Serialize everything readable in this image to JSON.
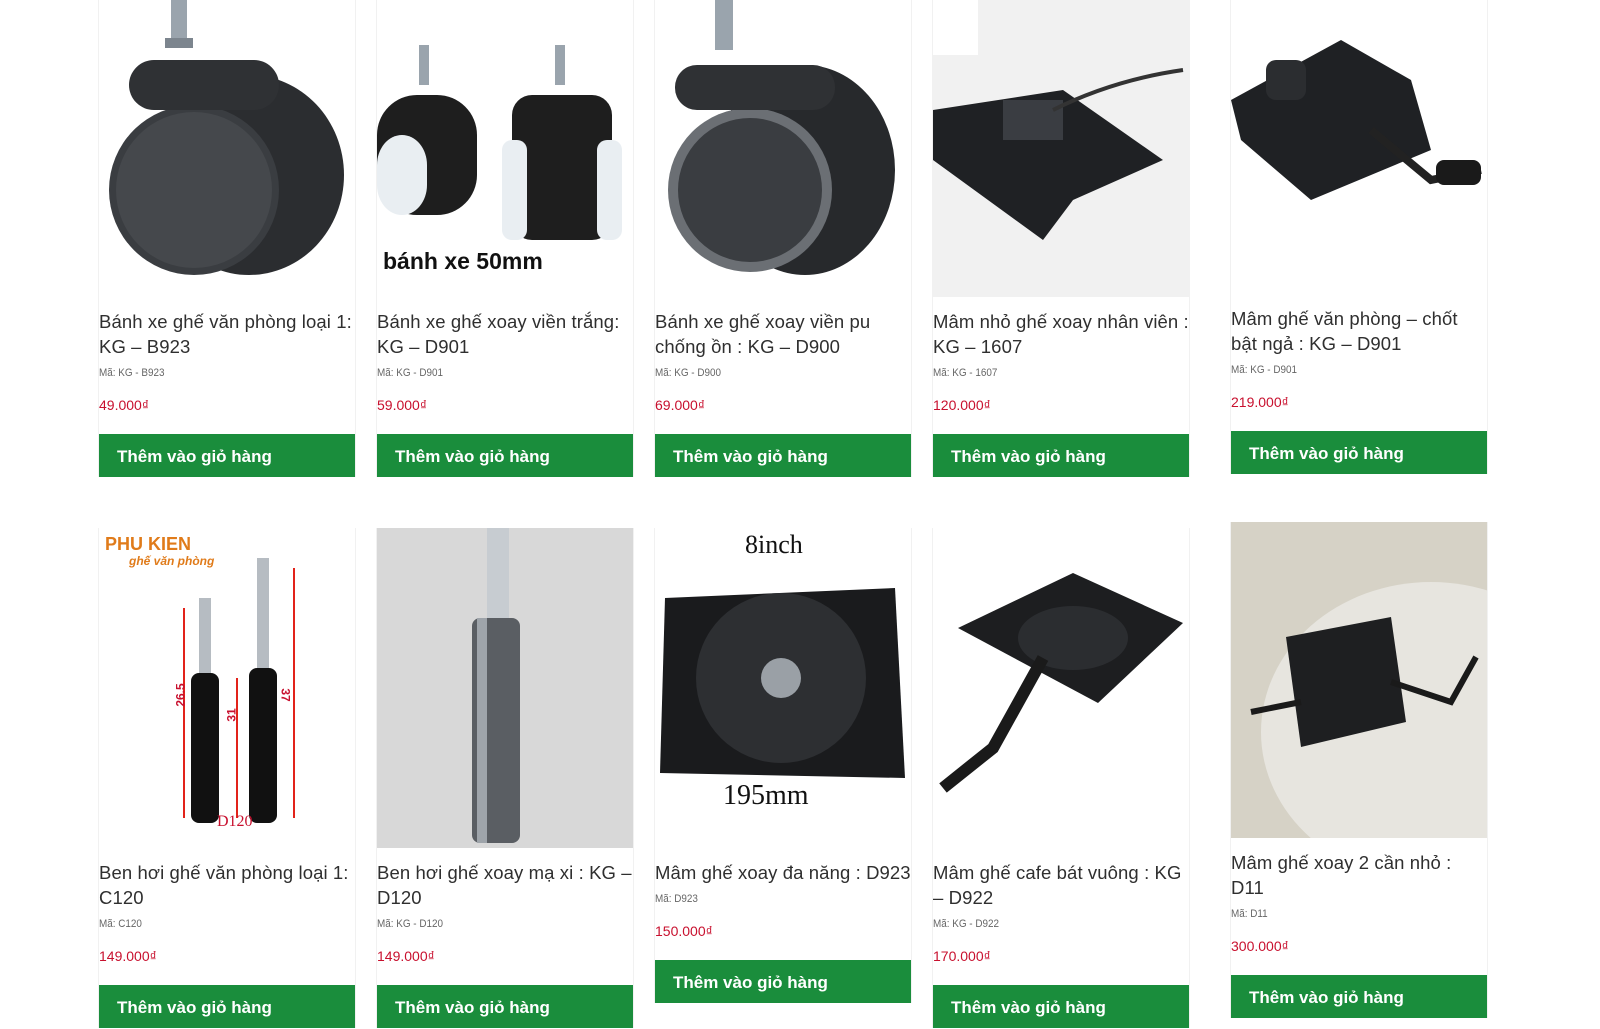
{
  "add_to_cart_label": "Thêm vào giỏ hàng",
  "colors": {
    "button": "#1a8d3c",
    "price": "#c8102e",
    "text": "#2f2f2f"
  },
  "row1": [
    {
      "name": "Bánh xe ghế văn phòng loại 1: KG – B923",
      "code": "Mã: KG - B923",
      "price": "49.000₫",
      "image_icon": "caster-wheel-image"
    },
    {
      "name": "Bánh xe ghế xoay viền trắng: KG – D901",
      "code": "Mã: KG - D901",
      "price": "59.000₫",
      "image_icon": "caster-wheel-white-image",
      "image_caption": "bánh xe 50mm"
    },
    {
      "name": "Bánh xe ghế xoay viền pu chống ồn : KG – D900",
      "code": "Mã: KG - D900",
      "price": "69.000₫",
      "image_icon": "caster-wheel-pu-image"
    },
    {
      "name": "Mâm nhỏ ghế xoay nhân viên : KG – 1607",
      "code": "Mã: KG - 1607",
      "price": "120.000₫",
      "image_icon": "chair-plate-small-image"
    },
    {
      "name": "Mâm ghế văn phòng – chốt bật ngả : KG – D901",
      "code": "Mã: KG - D901",
      "price": "219.000₫",
      "image_icon": "chair-plate-lock-image"
    }
  ],
  "row2": [
    {
      "name": "Ben hơi ghế văn phòng loại 1: C120",
      "code": "Mã: C120",
      "price": "149.000₫",
      "image_icon": "gas-lift-pair-image",
      "image_logo": "PHU KIEN",
      "image_logo_sub": "ghế văn phòng",
      "image_caption": "D120",
      "dim_a": "26.5",
      "dim_b": "37",
      "dim_c": "31"
    },
    {
      "name": "Ben hơi ghế xoay mạ xi : KG – D120",
      "code": "Mã: KG - D120",
      "price": "149.000₫",
      "image_icon": "gas-lift-chrome-image"
    },
    {
      "name": "Mâm ghế xoay đa năng : D923",
      "code": "Mã: D923",
      "price": "150.000₫",
      "image_icon": "swivel-plate-image",
      "image_caption_top": "8inch",
      "image_caption_bottom": "195mm"
    },
    {
      "name": "Mâm ghế cafe bát vuông : KG – D922",
      "code": "Mã: KG - D922",
      "price": "170.000₫",
      "image_icon": "cafe-chair-plate-image"
    },
    {
      "name": "Mâm ghế xoay 2 cần nhỏ : D11",
      "code": "Mã: D11",
      "price": "300.000₫",
      "image_icon": "double-lever-plate-image"
    }
  ]
}
